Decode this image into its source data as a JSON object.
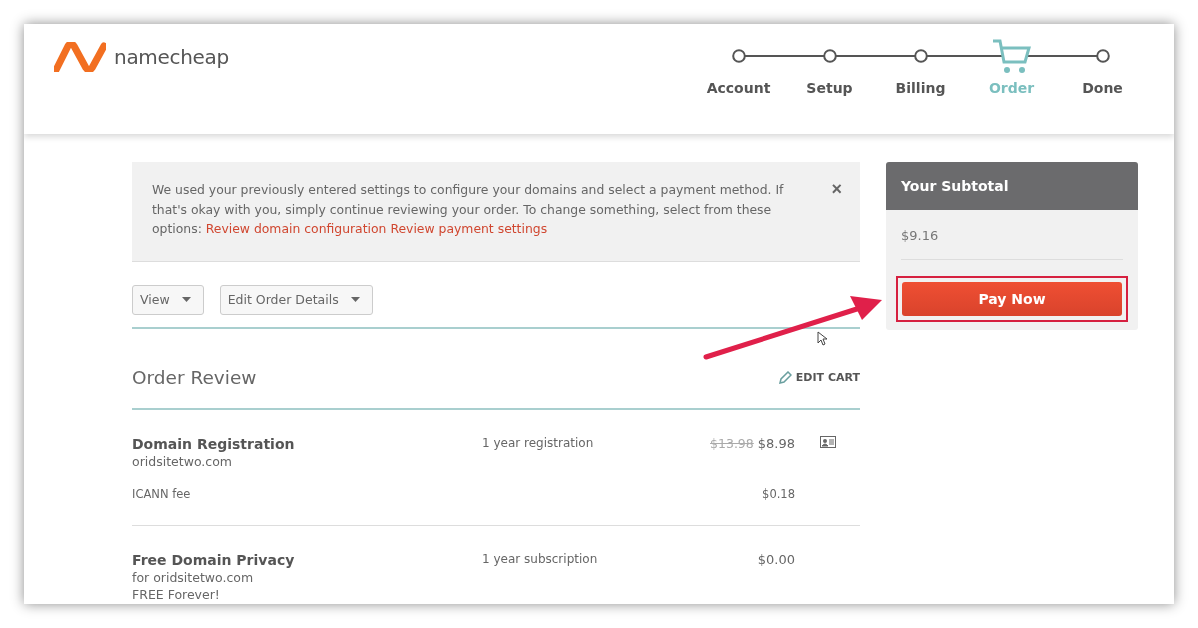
{
  "logo": {
    "text": "namecheap"
  },
  "steps": [
    {
      "label": "Account",
      "selected": false
    },
    {
      "label": "Setup",
      "selected": false
    },
    {
      "label": "Billing",
      "selected": false
    },
    {
      "label": "Order",
      "selected": true
    },
    {
      "label": "Done",
      "selected": false
    }
  ],
  "notice": {
    "text": "We used your previously entered settings to configure your domains and select a payment method. If that's okay with you, simply continue reviewing your order. To change something, select from these options: ",
    "links": [
      "Review domain configuration",
      "Review payment settings"
    ],
    "close": "×"
  },
  "dropdowns": [
    "View",
    "Edit Order Details"
  ],
  "order_review": {
    "title": "Order Review",
    "edit_link": "EDIT CART"
  },
  "items": [
    {
      "title": "Domain Registration",
      "subtitle": "oridsitetwo.com",
      "term": "1 year registration",
      "old_price": "$13.98",
      "price": "$8.98",
      "fees": [
        {
          "label": "ICANN fee",
          "price": "$0.18"
        }
      ]
    },
    {
      "title": "Free Domain Privacy",
      "subtitle": "for oridsitetwo.com",
      "note": "FREE Forever!",
      "term": "1 year subscription",
      "price": "$0.00"
    }
  ],
  "subtotal": {
    "title": "Your Subtotal",
    "amount": "$9.16",
    "button": "Pay Now"
  }
}
